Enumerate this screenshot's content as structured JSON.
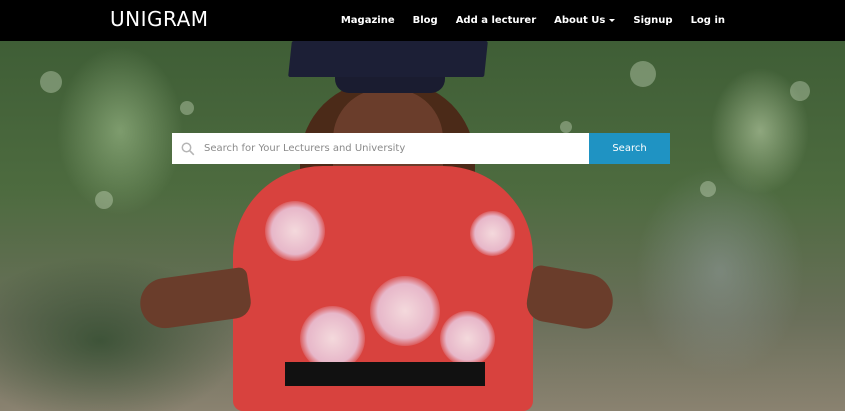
{
  "navbar": {
    "brand": "UNIGRAM",
    "links": [
      {
        "label": "Magazine"
      },
      {
        "label": "Blog"
      },
      {
        "label": "Add a lecturer"
      },
      {
        "label": "About Us",
        "dropdown": true
      },
      {
        "label": "Signup"
      },
      {
        "label": "Log in"
      }
    ]
  },
  "search": {
    "placeholder": "Search for Your Lecturers and University",
    "value": "",
    "button_label": "Search",
    "icon": "search-icon"
  },
  "colors": {
    "navbar_bg": "#000000",
    "search_button_bg": "#1f93c3",
    "nav_text": "#ffffff"
  }
}
